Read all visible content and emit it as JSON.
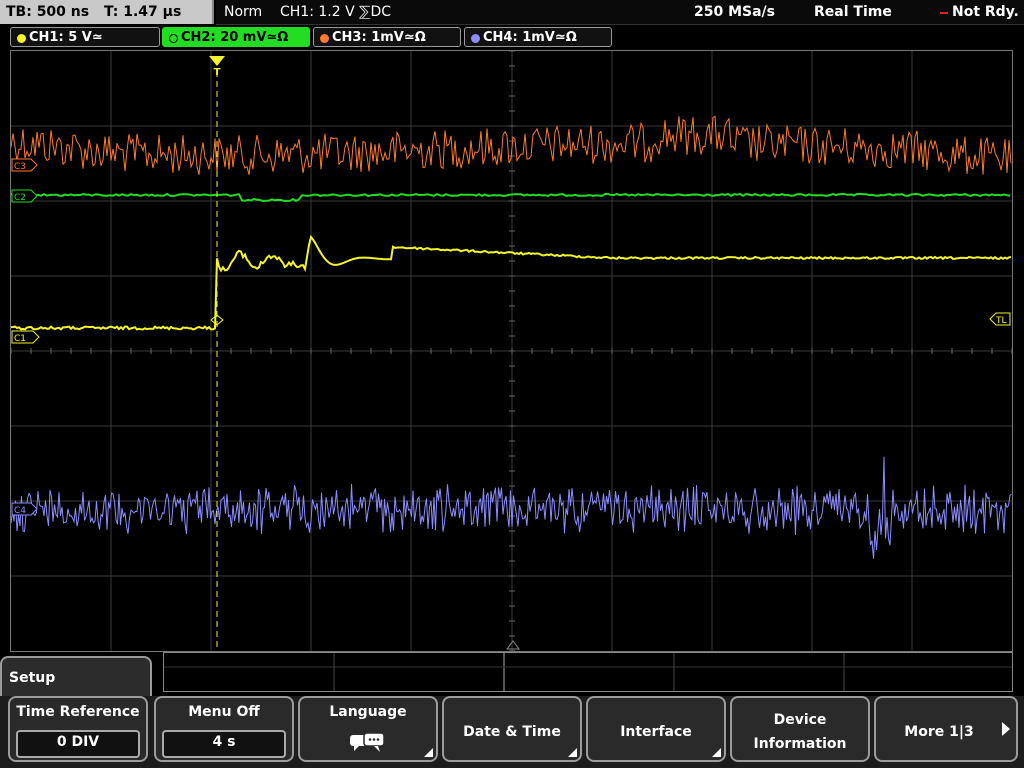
{
  "status": {
    "timebase": "TB: 500 ns",
    "trigger_time": "T: 1.47 µs",
    "mode": "Norm",
    "trigger_setting": "CH1: 1.2 V ⅀DC",
    "sample_rate": "250 MSa/s",
    "acq_mode": "Real Time",
    "state": "Not Rdy."
  },
  "channels": [
    {
      "label": "CH1: 5 V≃",
      "color": "#f4f428",
      "active": false
    },
    {
      "label": "CH2: 20 mV≃Ω",
      "color": "#22dd22",
      "active": true
    },
    {
      "label": "CH3: 1mV≃Ω",
      "color": "#ff7a2a",
      "active": false
    },
    {
      "label": "CH4: 1mV≃Ω",
      "color": "#8c8cff",
      "active": false
    }
  ],
  "markers": {
    "ch1": "C1",
    "ch2": "C2",
    "ch3": "C3",
    "ch4": "C4",
    "trigger_level": "TL",
    "trigger_pos": "T"
  },
  "menu": {
    "tab": "Setup",
    "time_reference": {
      "label": "Time Reference",
      "value": "0 DIV"
    },
    "menu_off": {
      "label": "Menu Off",
      "value": "4 s"
    },
    "language": {
      "label": "Language"
    },
    "date_time": {
      "label": "Date & Time"
    },
    "interface": {
      "label": "Interface"
    },
    "device_info": {
      "label1": "Device",
      "label2": "Information"
    },
    "more": {
      "label": "More 1|3"
    }
  },
  "icons": [
    "speech-bubbles-icon",
    "submenu-corner-icon",
    "next-arrow-icon",
    "trigger-marker-icon"
  ]
}
